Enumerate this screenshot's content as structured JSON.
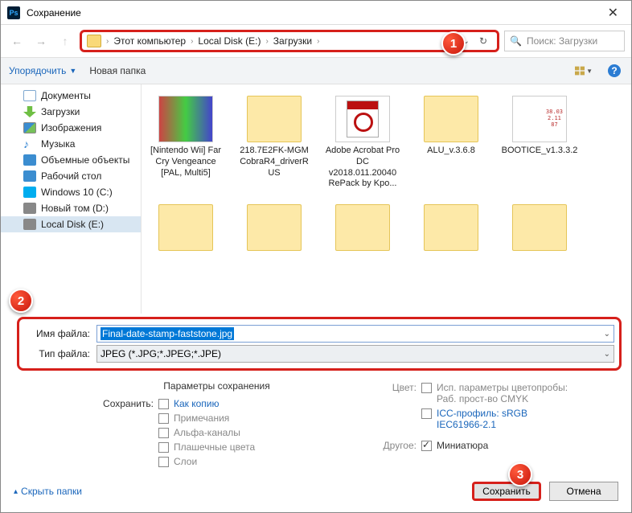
{
  "title": "Сохранение",
  "breadcrumb": {
    "pc": "Этот компьютер",
    "disk": "Local Disk (E:)",
    "dl": "Загрузки"
  },
  "search": {
    "placeholder": "Поиск: Загрузки"
  },
  "toolbar": {
    "organize": "Упорядочить",
    "newfolder": "Новая папка"
  },
  "sidebar": [
    {
      "label": "Документы",
      "ic": "ic-doc"
    },
    {
      "label": "Загрузки",
      "ic": "ic-dl"
    },
    {
      "label": "Изображения",
      "ic": "ic-img"
    },
    {
      "label": "Музыка",
      "ic": "ic-mus"
    },
    {
      "label": "Объемные объекты",
      "ic": "ic-3d"
    },
    {
      "label": "Рабочий стол",
      "ic": "ic-desk"
    },
    {
      "label": "Windows 10 (C:)",
      "ic": "ic-win"
    },
    {
      "label": "Новый том (D:)",
      "ic": "ic-disk"
    },
    {
      "label": "Local Disk (E:)",
      "ic": "ic-disk",
      "sel": true
    }
  ],
  "files": [
    {
      "label": "[Nintendo Wii] Far Cry Vengeance [PAL, Multi5]",
      "thumb": "game"
    },
    {
      "label": "218.7E2FK-MGM CobraR4_driverR US",
      "thumb": "folder"
    },
    {
      "label": "Adobe Acrobat Pro DC v2018.011.20040 RePack by Kpo...",
      "thumb": "acrobat"
    },
    {
      "label": "ALU_v.3.6.8",
      "thumb": "folder"
    },
    {
      "label": "BOOTICE_v1.3.3.2",
      "thumb": "bootice"
    }
  ],
  "filename": {
    "label": "Имя файла:",
    "value": "Final-date-stamp-faststone.jpg"
  },
  "filetype": {
    "label": "Тип файла:",
    "value": "JPEG (*.JPG;*.JPEG;*.JPE)"
  },
  "options": {
    "heading": "Параметры сохранения",
    "saveAs": "Сохранить:",
    "asCopy": "Как копию",
    "notes": "Примечания",
    "alpha": "Альфа-каналы",
    "spot": "Плашечные цвета",
    "layers": "Слои",
    "colorLabel": "Цвет:",
    "colorProof": "Исп. параметры цветопробы:  Раб. прост-во CMYK",
    "icc": "ICC-профиль: sRGB IEC61966-2.1",
    "other": "Другое:",
    "thumb": "Миниатюра"
  },
  "bottom": {
    "hide": "Скрыть папки",
    "save": "Сохранить",
    "cancel": "Отмена"
  }
}
